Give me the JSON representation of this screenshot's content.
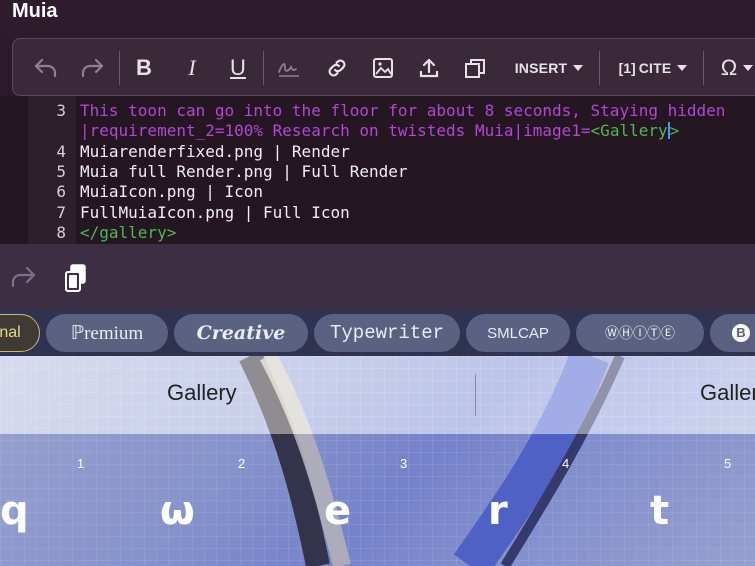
{
  "app": {
    "title": "Muia"
  },
  "toolbar": {
    "undo_icon": "undo-icon",
    "redo_icon": "redo-icon",
    "bold_label": "B",
    "italic_label": "I",
    "underline_label": "U",
    "insert_label": "INSERT",
    "cite_label": "CITE",
    "special_chars_label": "Ω"
  },
  "editor": {
    "lines": [
      {
        "num": "3",
        "text": "This toon can go into the floor for about 8 seconds, Staying hidden"
      },
      {
        "num": "",
        "text_before": "|requirement_2=100% Research on twisteds Muia|image1=",
        "text_tag": "<Gallery",
        "text_after": ">"
      },
      {
        "num": "4",
        "text": "Muiarenderfixed.png | Render"
      },
      {
        "num": "5",
        "text": "Muia full Render.png | Full Render"
      },
      {
        "num": "6",
        "text": "MuiaIcon.png | Icon"
      },
      {
        "num": "7",
        "text": "FullMuiaIcon.png | Full Icon"
      },
      {
        "num": "8",
        "text": "</gallery>"
      }
    ]
  },
  "font_styles": [
    {
      "label": "nal",
      "selected": true
    },
    {
      "label": "ℙremium",
      "selected": false
    },
    {
      "label": "Creative",
      "selected": false
    },
    {
      "label": "Typewriter",
      "selected": false
    },
    {
      "label": "SMLCAP",
      "selected": false
    },
    {
      "label": "ⓌⒽⒾⓉⒺ",
      "selected": false
    },
    {
      "label": "B",
      "selected": false
    }
  ],
  "suggestions": [
    "Gallery",
    "Galler"
  ],
  "number_hints": [
    "1",
    "2",
    "3",
    "4",
    "5"
  ],
  "keys": [
    "q",
    "ω",
    "e",
    "r",
    "t"
  ],
  "colors": {
    "tag_green": "#4fba4f",
    "text_purple": "#b545d6",
    "selected_pill_border": "#c9b96a"
  }
}
